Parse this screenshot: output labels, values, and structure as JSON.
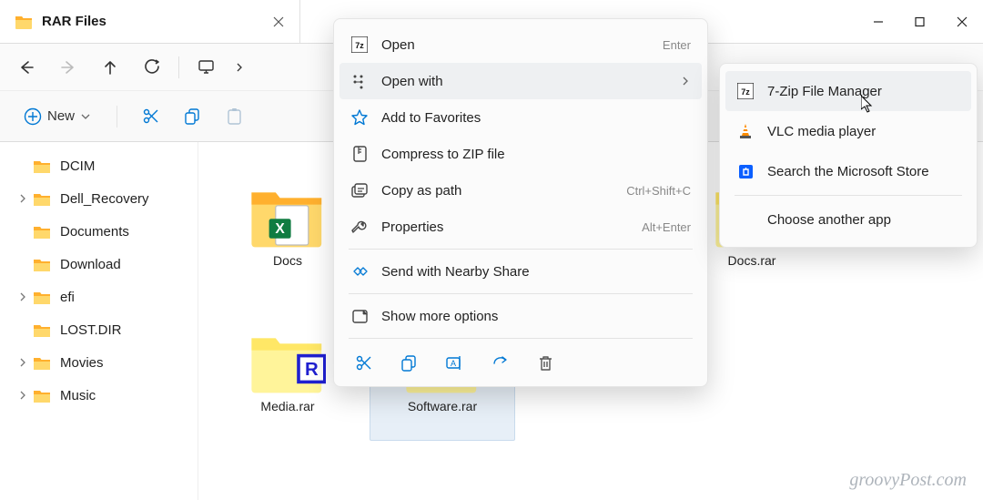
{
  "tab": {
    "title": "RAR Files"
  },
  "toolbar": {
    "new": "New"
  },
  "sidebar": {
    "items": [
      {
        "label": "DCIM",
        "has_chevron": false
      },
      {
        "label": "Dell_Recovery",
        "has_chevron": true
      },
      {
        "label": "Documents",
        "has_chevron": false
      },
      {
        "label": "Download",
        "has_chevron": false
      },
      {
        "label": "efi",
        "has_chevron": true
      },
      {
        "label": "LOST.DIR",
        "has_chevron": false
      },
      {
        "label": "Movies",
        "has_chevron": true
      },
      {
        "label": "Music",
        "has_chevron": true
      }
    ]
  },
  "files": {
    "items": [
      {
        "label": "Docs",
        "kind": "folder"
      },
      {
        "label": "Docs.rar",
        "kind": "rar"
      },
      {
        "label": "Media.rar",
        "kind": "rar"
      },
      {
        "label": "Software.rar",
        "kind": "rar"
      }
    ]
  },
  "ctx": {
    "open": "Open",
    "open_kb": "Enter",
    "open_with": "Open with",
    "favorites": "Add to Favorites",
    "compress": "Compress to ZIP file",
    "copypath": "Copy as path",
    "copypath_kb": "Ctrl+Shift+C",
    "properties": "Properties",
    "properties_kb": "Alt+Enter",
    "nearby": "Send with Nearby Share",
    "more": "Show more options"
  },
  "openwith": {
    "seven_zip": "7-Zip File Manager",
    "vlc": "VLC media player",
    "store": "Search the Microsoft Store",
    "another": "Choose another app"
  },
  "watermark": "groovyPost.com"
}
